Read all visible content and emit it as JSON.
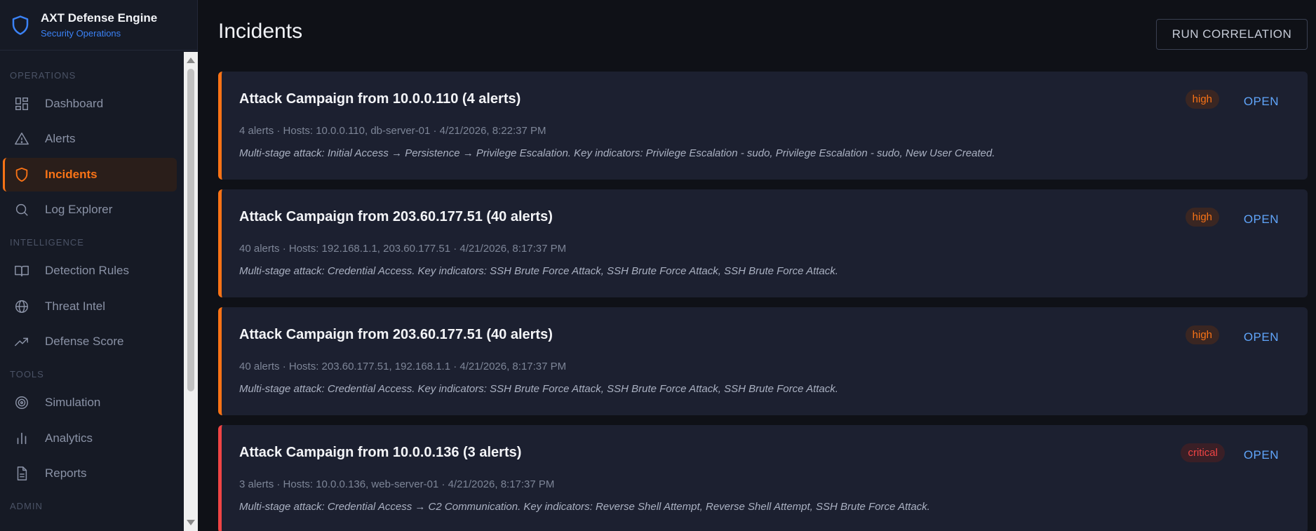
{
  "brand": {
    "title": "AXT Defense Engine",
    "subtitle": "Security Operations"
  },
  "sidebar": {
    "sections": [
      {
        "label": "OPERATIONS"
      },
      {
        "label": "INTELLIGENCE"
      },
      {
        "label": "TOOLS"
      },
      {
        "label": "ADMIN"
      }
    ],
    "items": [
      {
        "label": "Dashboard",
        "icon": "dashboard-icon"
      },
      {
        "label": "Alerts",
        "icon": "warning-icon"
      },
      {
        "label": "Incidents",
        "icon": "shield-icon",
        "active": true
      },
      {
        "label": "Log Explorer",
        "icon": "search-icon"
      },
      {
        "label": "Detection Rules",
        "icon": "book-icon"
      },
      {
        "label": "Threat Intel",
        "icon": "globe-icon"
      },
      {
        "label": "Defense Score",
        "icon": "trending-up-icon"
      },
      {
        "label": "Simulation",
        "icon": "target-icon"
      },
      {
        "label": "Analytics",
        "icon": "bar-chart-icon"
      },
      {
        "label": "Reports",
        "icon": "document-icon"
      }
    ]
  },
  "page": {
    "title": "Incidents",
    "run_button": "RUN CORRELATION"
  },
  "incidents": [
    {
      "title": "Attack Campaign from 10.0.0.110 (4 alerts)",
      "meta": "4 alerts · Hosts: 10.0.0.110, db-server-01 · 4/21/2026, 8:22:37 PM",
      "description": "Multi-stage attack: Initial Access → Persistence → Privilege Escalation. Key indicators: Privilege Escalation - sudo, Privilege Escalation - sudo, New User Created.",
      "severity": "high",
      "status": "OPEN"
    },
    {
      "title": "Attack Campaign from 203.60.177.51 (40 alerts)",
      "meta": "40 alerts · Hosts: 192.168.1.1, 203.60.177.51 · 4/21/2026, 8:17:37 PM",
      "description": "Multi-stage attack: Credential Access. Key indicators: SSH Brute Force Attack, SSH Brute Force Attack, SSH Brute Force Attack.",
      "severity": "high",
      "status": "OPEN"
    },
    {
      "title": "Attack Campaign from 203.60.177.51 (40 alerts)",
      "meta": "40 alerts · Hosts: 203.60.177.51, 192.168.1.1 · 4/21/2026, 8:17:37 PM",
      "description": "Multi-stage attack: Credential Access. Key indicators: SSH Brute Force Attack, SSH Brute Force Attack, SSH Brute Force Attack.",
      "severity": "high",
      "status": "OPEN"
    },
    {
      "title": "Attack Campaign from 10.0.0.136 (3 alerts)",
      "meta": "3 alerts · Hosts: 10.0.0.136, web-server-01 · 4/21/2026, 8:17:37 PM",
      "description": "Multi-stage attack: Credential Access → C2 Communication. Key indicators: Reverse Shell Attempt, Reverse Shell Attempt, SSH Brute Force Attack.",
      "severity": "critical",
      "status": "OPEN"
    }
  ],
  "colors": {
    "accent": "#f97316",
    "critical": "#ef4444",
    "link": "#60a5fa",
    "brand": "#3b82f6"
  }
}
